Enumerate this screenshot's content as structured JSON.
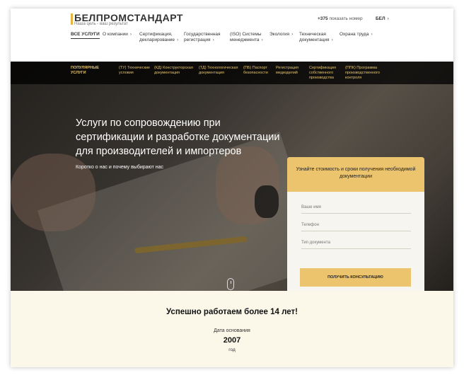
{
  "header": {
    "logo": "БЕЛПРОМСТАНДАРТ",
    "tagline": "Наша цель - ваш результат",
    "phone_code": "+375",
    "phone_link": "показать номер",
    "lang": "БЕЛ"
  },
  "nav": [
    "ВСЕ УСЛУГИ",
    "О компании",
    "Сертификация, декларирование",
    "Государственная регистрация",
    "(ISO) Системы менеджмента",
    "Экология",
    "Техническая документация",
    "Охрана труда"
  ],
  "subnav": [
    "ПОПУЛЯРНЫЕ УСЛУГИ",
    "(ТУ) Технические условия",
    "(КД) Конструкторская документация",
    "(ТД) Технологическая документация",
    "(ПБ) Паспорт безопасности",
    "Регистрация медизделий",
    "Сертификация собственного производства",
    "(ППК) Программа производственного контроля"
  ],
  "hero": {
    "title": "Услуги по сопровождению при сертификации и разработке документации для производителей и импортеров",
    "link": "Коротко о нас и почему выбирают нас"
  },
  "form": {
    "heading": "Узнайте стоимость и сроки получения необходимой документации",
    "name_placeholder": "Ваше имя",
    "phone_placeholder": "Телефон",
    "doc_placeholder": "Тип документа",
    "submit": "ПОЛУЧИТЬ КОНСУЛЬТАЦИЮ"
  },
  "stats": {
    "title": "Успешно работаем более 14 лет!",
    "caption": "Дата основания",
    "year": "2007",
    "unit": "год"
  },
  "colors": {
    "accent": "#edc46e",
    "subnav_text": "#e5c46d",
    "stats_bg": "#fbf8ea"
  }
}
